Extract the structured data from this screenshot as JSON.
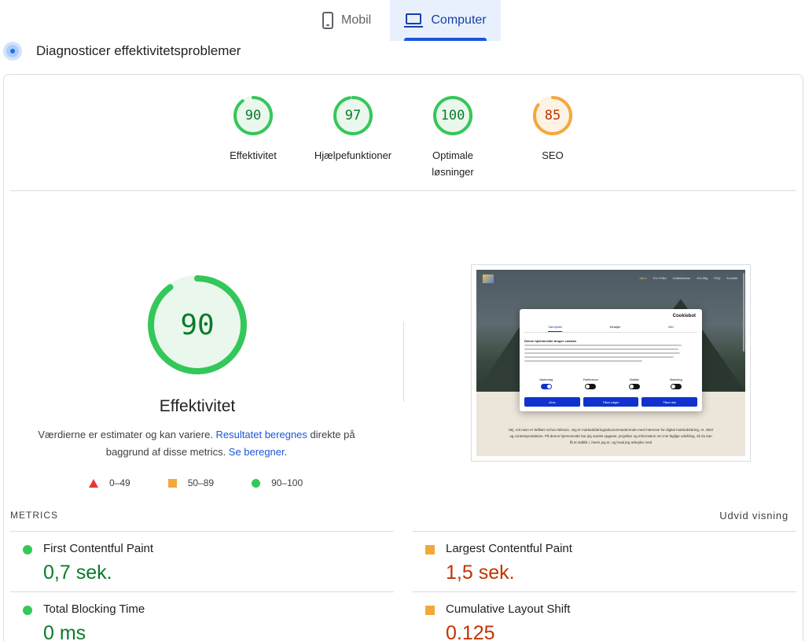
{
  "tabs": [
    {
      "label": "Mobil",
      "icon": "phone-icon",
      "active": false
    },
    {
      "label": "Computer",
      "icon": "laptop-icon",
      "active": true
    }
  ],
  "diagnose": {
    "title": "Diagnosticer effektivitetsproblemer",
    "icon": "pulse-icon"
  },
  "categories": [
    {
      "score": "90",
      "label": "Effektivitet",
      "rating": "pass",
      "fraction": 0.9
    },
    {
      "score": "97",
      "label": "Hjælpefunktioner",
      "rating": "pass",
      "fraction": 0.97
    },
    {
      "score": "100",
      "label": "Optimale løsninger",
      "rating": "pass",
      "fraction": 1.0
    },
    {
      "score": "85",
      "label": "SEO",
      "rating": "average",
      "fraction": 0.85
    }
  ],
  "performance": {
    "score": "90",
    "fraction": 0.9,
    "title": "Effektivitet",
    "disclaimer_1": "Værdierne er estimater og kan variere. ",
    "disclaimer_link_1": "Resultatet beregnes",
    "disclaimer_2": " direkte på baggrund af disse metrics. ",
    "disclaimer_link_2": "Se beregner",
    "disclaimer_3": "."
  },
  "legend": [
    {
      "shape": "triangle",
      "range": "0–49",
      "color": "#e53935"
    },
    {
      "shape": "square",
      "range": "50–89",
      "color": "#f4a83a"
    },
    {
      "shape": "circle",
      "range": "90–100",
      "color": "#34c759"
    }
  ],
  "thumbnail": {
    "nav": [
      "Hjem",
      "For Folks",
      "Udtalelsesse",
      "Om Mig",
      "FAQ",
      "Kontakt"
    ],
    "dialog_brand": "Cookiebot",
    "dialog_tabs": [
      "Samtykke",
      "Detaljer",
      "Om"
    ],
    "dialog_heading": "Denne hjemmeside bruger cookies",
    "toggles": [
      {
        "label": "Nødvendig",
        "on": true
      },
      {
        "label": "Præferencer",
        "on": false
      },
      {
        "label": "Statistik",
        "on": false
      },
      {
        "label": "Marketing",
        "on": false
      }
    ],
    "buttons": [
      "Afvis",
      "Tillad valgte",
      "Tillad alle"
    ],
    "site_text": "Hej, mit navn er William Schou Nilsson. Jeg er markedsføringsøkonomstuderende med interesse for digital markedsføring, AI, SEO og contentproduktion. På denne hjemmeside har jeg samlet opgaver, projekter og information om min faglige udvikling, så du kan få et indblik i, hvem jeg er, og hvad jeg arbejder med"
  },
  "metrics": {
    "label": "METRICS",
    "expand_label": "Udvid visning",
    "items": [
      {
        "name": "First Contentful Paint",
        "value": "0,7 sek.",
        "rating": "good"
      },
      {
        "name": "Largest Contentful Paint",
        "value": "1,5 sek.",
        "rating": "average"
      },
      {
        "name": "Total Blocking Time",
        "value": "0 ms",
        "rating": "good"
      },
      {
        "name": "Cumulative Layout Shift",
        "value": "0.125",
        "rating": "average"
      }
    ]
  },
  "colors": {
    "pass_ring": "#34c759",
    "pass_fill": "#eaf7ed",
    "average_ring": "#f4a83a",
    "average_fill": "#fdf3e5",
    "accent": "#1a56db"
  }
}
